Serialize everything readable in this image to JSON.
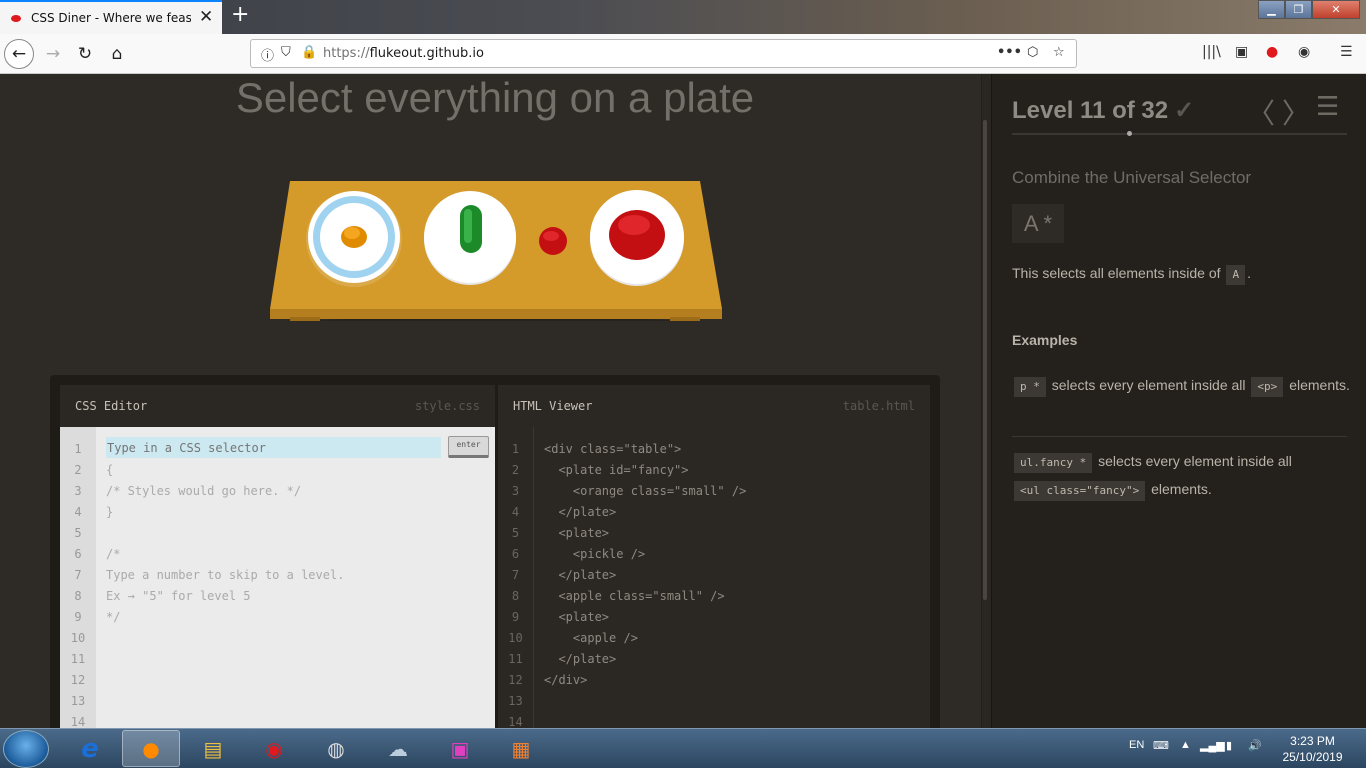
{
  "browser": {
    "tab_title": "CSS Diner - Where we feast on CSS",
    "url_prefix": "https://",
    "url_domain": "flukeout.github.io",
    "new_tab_label": "+",
    "close_tab_label": "✕",
    "page_actions_label": "•••"
  },
  "game": {
    "instruction": "Select everything on a plate"
  },
  "css_editor": {
    "title": "CSS Editor",
    "filename": "style.css",
    "input_placeholder": "Type in a CSS selector",
    "enter_label": "enter",
    "line_numbers": [
      "1",
      "2",
      "3",
      "4",
      "5",
      "6",
      "7",
      "8",
      "9",
      "10",
      "11",
      "12",
      "13",
      "14"
    ],
    "lines": [
      "",
      "{",
      "/* Styles would go here. */",
      "}",
      "",
      "/*",
      "Type a number to skip to a level.",
      "Ex → \"5\" for level 5",
      "*/",
      "",
      "",
      "",
      "",
      ""
    ]
  },
  "html_viewer": {
    "title": "HTML Viewer",
    "filename": "table.html",
    "line_numbers": [
      "1",
      "2",
      "3",
      "4",
      "5",
      "6",
      "7",
      "8",
      "9",
      "10",
      "11",
      "12",
      "13",
      "14"
    ],
    "lines": [
      "<div class=\"table\">",
      "  <plate id=\"fancy\">",
      "    <orange class=\"small\" />",
      "  </plate>",
      "  <plate>",
      "    <pickle />",
      "  </plate>",
      "  <apple class=\"small\" />",
      "  <plate>",
      "    <apple />",
      "  </plate>",
      "</div>",
      "",
      ""
    ]
  },
  "sidebar": {
    "level_title": "Level 11 of 32",
    "level_check": "✓",
    "level_progress": 0.34,
    "selector_name": "Combine the Universal Selector",
    "syntax": "A  *",
    "desc_before": "This selects all elements inside of",
    "desc_tag": "A",
    "desc_after": ".",
    "examples_heading": "Examples",
    "example1_code": "p  *",
    "example1_text_a": "selects every element inside all",
    "example1_tag": "<p>",
    "example1_text_b": "elements.",
    "example2_code": "ul.fancy  *",
    "example2_text_a": "selects every element inside all",
    "example2_tag": "<ul class=\"fancy\">",
    "example2_text_b": "elements."
  },
  "taskbar": {
    "lang": "EN",
    "time": "3:23 PM",
    "date": "25/10/2019"
  }
}
